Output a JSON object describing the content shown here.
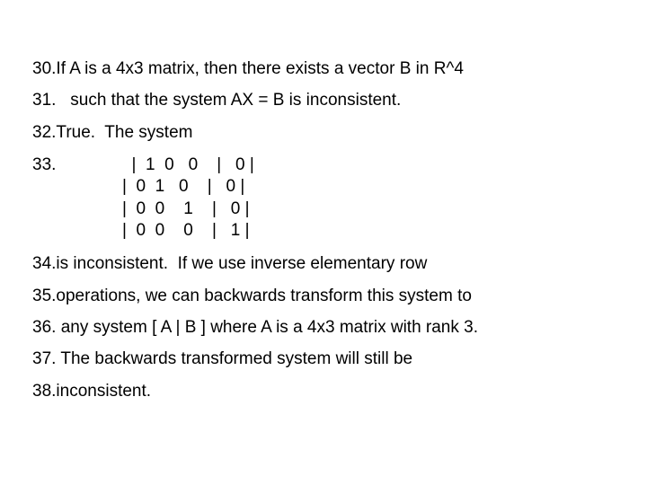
{
  "lines": {
    "l30": {
      "num": "30.",
      "text": "If A is a 4x3 matrix, then there exists a vector B in R^4"
    },
    "l31": {
      "num": "31.",
      "text": "   such that the system AX = B is inconsistent."
    },
    "l32": {
      "num": "32.",
      "text": "True.  The system"
    },
    "l33": {
      "num": "33."
    },
    "l34": {
      "num": "34.",
      "text": "is inconsistent.  If we use inverse elementary row"
    },
    "l35": {
      "num": "35.",
      "text": "operations, we can backwards transform this system to"
    },
    "l36": {
      "num": "36.",
      "text": " any system [ A | B ] where A is a 4x3 matrix with rank 3."
    },
    "l37": {
      "num": "37.",
      "text": " The backwards transformed system will still be"
    },
    "l38": {
      "num": "38.",
      "text": "inconsistent."
    }
  },
  "matrix": {
    "r1": "  |  1  0   0    |   0 |",
    "r2": "|  0  1   0    |   0 |",
    "r3": "|  0  0    1    |   0 |",
    "r4": "|  0  0    0    |   1 |"
  }
}
